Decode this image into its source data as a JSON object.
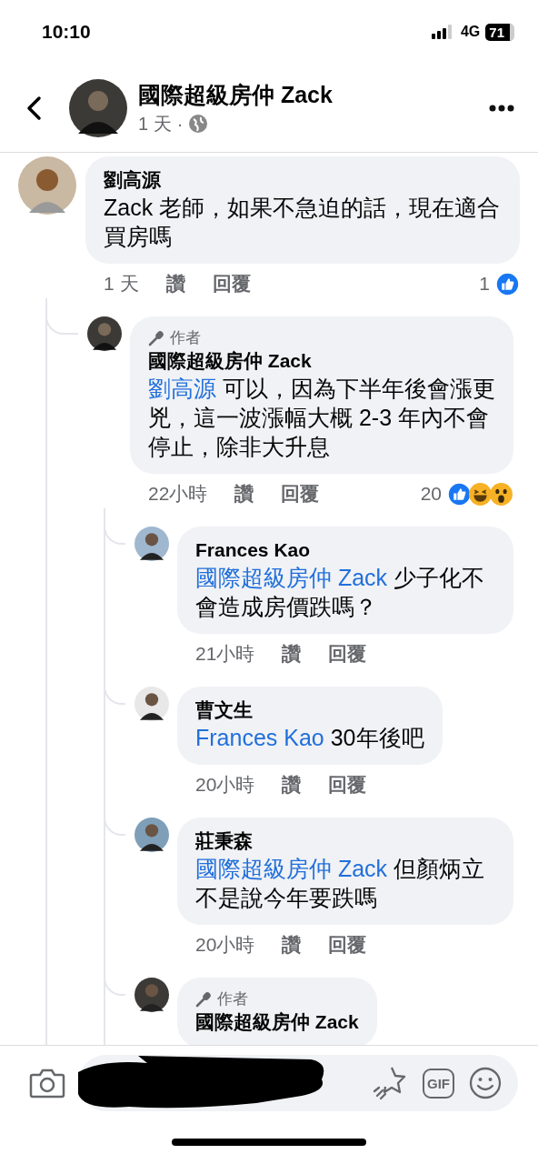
{
  "status_bar": {
    "time": "10:10",
    "network": "4G",
    "battery": "71"
  },
  "input_bar": {
    "gif": "GIF"
  },
  "header": {
    "title": "國際超級房仲 Zack",
    "time": "1 天",
    "separator": "·"
  },
  "comments": [
    {
      "author": "劉高源",
      "text": "Zack 老師，如果不急迫的話，現在適合買房嗎",
      "time": "1 天",
      "like": "讚",
      "reply": "回覆",
      "reaction_count": "1",
      "reactions": [
        {
          "kind": "like"
        }
      ],
      "children": [
        {
          "author": "國際超級房仲 Zack",
          "badge": "作者",
          "mention": "劉高源",
          "text": "可以，因為下半年後會漲更兇，這一波漲幅大概 2-3 年內不會停止，除非大升息",
          "time": "22小時",
          "like": "讚",
          "reply": "回覆",
          "reaction_count": "20",
          "reactions": [
            {
              "kind": "like"
            },
            {
              "kind": "haha"
            },
            {
              "kind": "wow"
            }
          ],
          "children": [
            {
              "author": "Frances Kao",
              "mention": "國際超級房仲 Zack",
              "text": "少子化不會造成房價跌嗎？",
              "time": "21小時",
              "like": "讚",
              "reply": "回覆"
            },
            {
              "author": "曹文生",
              "mention": "Frances Kao",
              "text": "30年後吧",
              "time": "20小時",
              "like": "讚",
              "reply": "回覆"
            },
            {
              "author": "莊秉森",
              "mention": "國際超級房仲 Zack",
              "text": "但顏炳立不是說今年要跌嗎",
              "time": "20小時",
              "like": "讚",
              "reply": "回覆"
            },
            {
              "author": "國際超級房仲 Zack",
              "badge": "作者"
            }
          ]
        }
      ]
    }
  ]
}
